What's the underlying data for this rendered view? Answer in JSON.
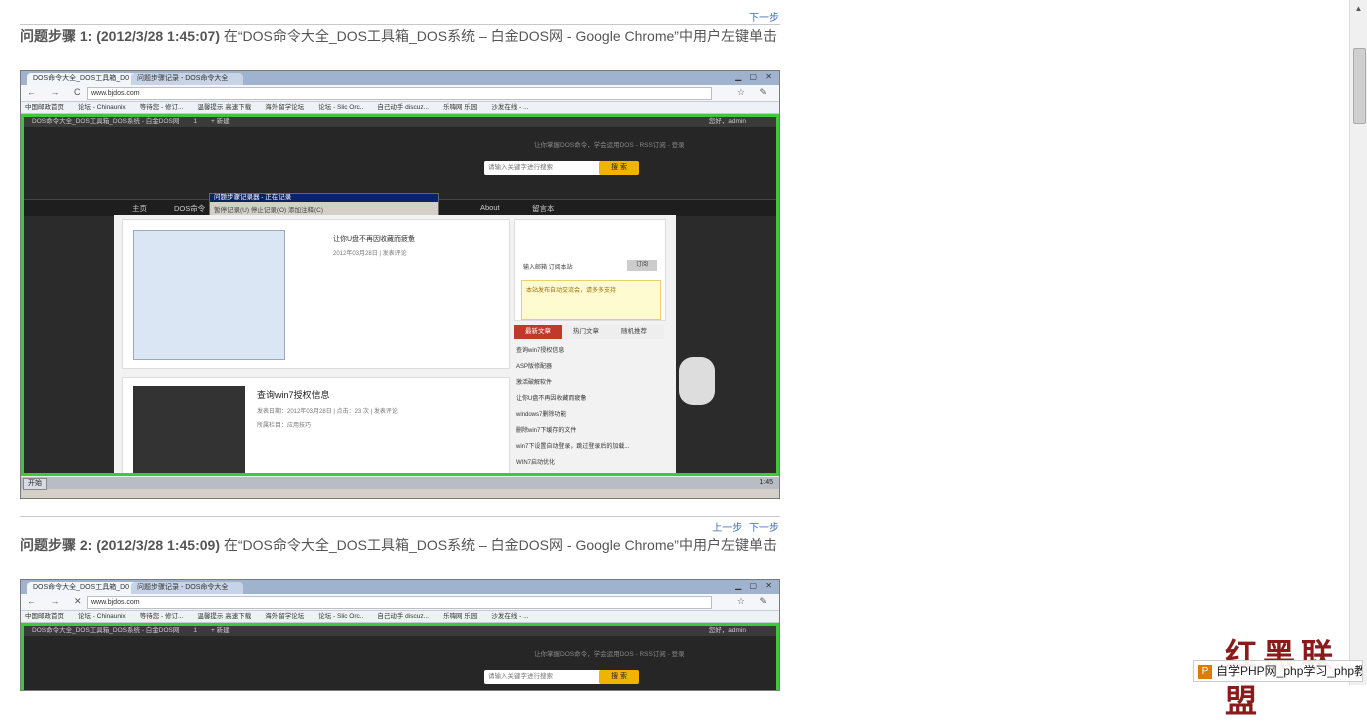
{
  "steps": [
    {
      "nav": {
        "prev": "",
        "next": "下一步"
      },
      "title_prefix": "问题步骤 1: (2012/3/28 1:45:07)",
      "title_rest": " 在“DOS命令大全_DOS工具箱_DOS系统 – 白金DOS网 - Google Chrome”中用户左键单击"
    },
    {
      "nav": {
        "prev": "上一步",
        "next": "下一步"
      },
      "title_prefix": "问题步骤 2: (2012/3/28 1:45:09)",
      "title_rest": " 在“DOS命令大全_DOS工具箱_DOS系统 – 白金DOS网 - Google Chrome”中用户左键单击"
    }
  ],
  "screenshot": {
    "tab_active": "DOS命令大全_DOS工具箱_D0 ×",
    "tab_other": "问题步骤记录 - DOS命令大全",
    "url": "www.bjdos.com",
    "bookmarks": [
      "中国邮政首页",
      "论坛 - Chinaunix",
      "等待您 - 修订...",
      "温馨提示 高速下载",
      "海外留学论坛",
      "论坛 - Slic Orc..",
      "自己动手 discuz...",
      "乐嗨网 乐园",
      "沙发在线 - ..."
    ],
    "wpbar": [
      "DOS命令大全_DOS工具箱_DOS系统 - 白金DOS网",
      "1",
      "+ 新建",
      "您好，admin"
    ],
    "tagline": "让你掌握DOS命令，学会运用DOS - RSS订阅 - 登录",
    "search_placeholder": "请输入关键字进行搜索",
    "search_button": "搜 索",
    "menu": [
      "主页",
      "DOS命令",
      "About",
      "留言本"
    ],
    "recorder_title": "问题步骤记录器 - 正在记录",
    "recorder_buttons": "暂停记录(U)  停止记录(O)  添加注释(C)",
    "post1_title": "让你U盘不再因收藏而疲惫",
    "post1_date": "2012年03月28日 | 发表评论",
    "post2_title": "查询win7授权信息",
    "post2_meta": "发表日期：2012年03月28日 | 点击：23 次 | 发表评论",
    "post2_cat": "所属栏目：应用技巧",
    "sidebar_subscribe": "输入邮箱 订阅本站",
    "sidebar_subscribe_btn": "订阅",
    "sidebar_notice": "本站发布自动交流会，请多多支持",
    "sidebar_tabs": [
      "最新文章",
      "热门文章",
      "随机推荐"
    ],
    "sidebar_list": [
      "查询win7授权信息",
      "ASP版修配器",
      "激活破解软件",
      "让你U盘不再因收藏而疲惫",
      "windows7删除功能",
      "删除win7下缓存的文件",
      "win7下设置自动登录，跳过登录后的加载...",
      "WIN7启动优化"
    ],
    "taskbar_start": "开始",
    "taskbar_clock": "1:45"
  },
  "watermark": "红黑联盟",
  "php_badge": "自学PHP网_php学习_php教程"
}
